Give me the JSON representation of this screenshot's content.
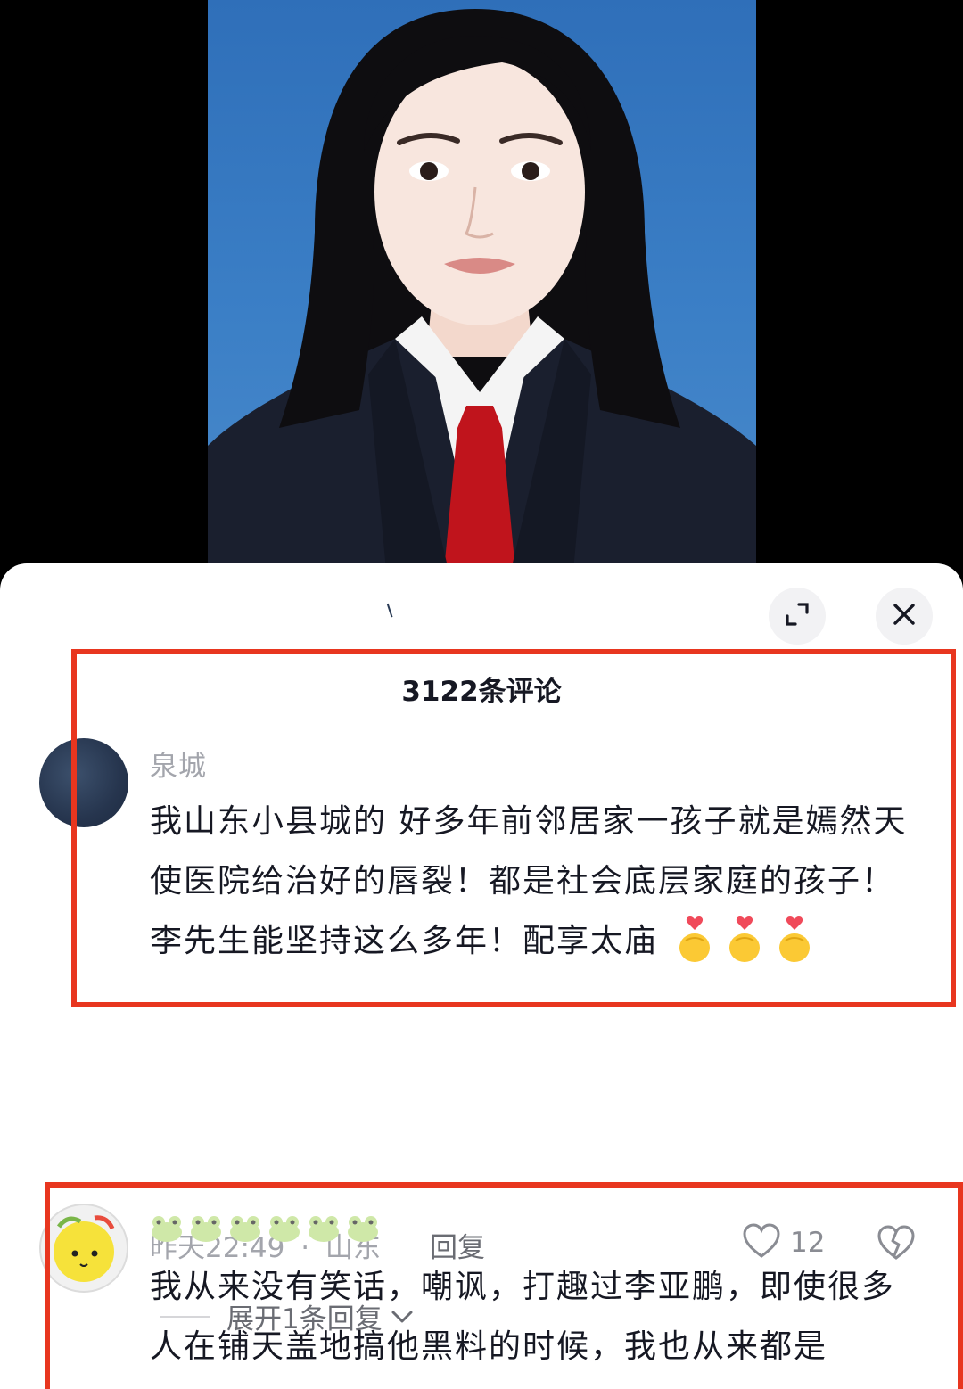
{
  "sheet": {
    "comment_count_title": "3122条评论"
  },
  "icons": {
    "expand": "expand-icon",
    "close": "close-icon",
    "like": "heart-outline-icon",
    "dislike": "broken-heart-icon",
    "chevron": "chevron-down-icon",
    "finger_heart": "finger-heart-emoji",
    "frog": "frog-emoji"
  },
  "colors": {
    "highlight_box": "#e8361f",
    "text_primary": "#161823",
    "text_secondary": "#a3a5ac",
    "sheet_bg": "#ffffff"
  },
  "comments": [
    {
      "username": "泉城",
      "text": "我山东小县城的  好多年前邻居家一孩子就是嫣然天使医院给治好的唇裂！都是社会底层家庭的孩子！李先生能坚持这么多年！配享太庙",
      "time": "昨天22:49",
      "separator": "·",
      "location": "山东",
      "reply_label": "回复",
      "likes": "12",
      "expand_replies": "展开1条回复"
    },
    {
      "text": "我从来没有笑话，嘲讽，打趣过李亚鹏，即使很多人在铺天盖地搞他黑料的时候，我也从来都是"
    }
  ]
}
